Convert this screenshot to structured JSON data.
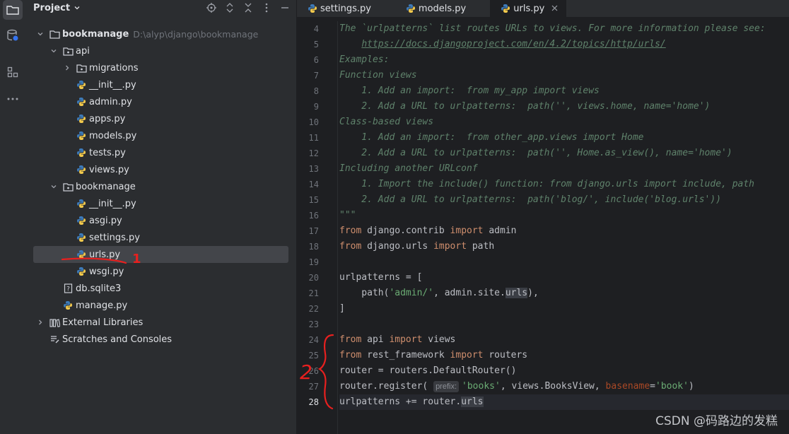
{
  "project_panel": {
    "title": "Project",
    "tree": [
      {
        "label": "bookmanage",
        "hint": "D:\\alyp\\django\\bookmanage",
        "icon": "folder-icon",
        "depth": 0,
        "expanded": true
      },
      {
        "label": "api",
        "icon": "package-folder-icon",
        "depth": 1,
        "expanded": true
      },
      {
        "label": "migrations",
        "icon": "package-folder-icon",
        "depth": 2,
        "expanded": false
      },
      {
        "label": "__init__.py",
        "icon": "python-file-icon",
        "depth": 2
      },
      {
        "label": "admin.py",
        "icon": "python-file-icon",
        "depth": 2
      },
      {
        "label": "apps.py",
        "icon": "python-file-icon",
        "depth": 2
      },
      {
        "label": "models.py",
        "icon": "python-file-icon",
        "depth": 2
      },
      {
        "label": "tests.py",
        "icon": "python-file-icon",
        "depth": 2
      },
      {
        "label": "views.py",
        "icon": "python-file-icon",
        "depth": 2
      },
      {
        "label": "bookmanage",
        "icon": "package-folder-icon",
        "depth": 1,
        "expanded": true
      },
      {
        "label": "__init__.py",
        "icon": "python-file-icon",
        "depth": 2
      },
      {
        "label": "asgi.py",
        "icon": "python-file-icon",
        "depth": 2
      },
      {
        "label": "settings.py",
        "icon": "python-file-icon",
        "depth": 2
      },
      {
        "label": "urls.py",
        "icon": "python-file-icon",
        "depth": 2,
        "selected": true
      },
      {
        "label": "wsgi.py",
        "icon": "python-file-icon",
        "depth": 2
      },
      {
        "label": "db.sqlite3",
        "icon": "unknown-file-icon",
        "depth": 1
      },
      {
        "label": "manage.py",
        "icon": "python-file-icon",
        "depth": 1
      },
      {
        "label": "External Libraries",
        "icon": "libraries-icon",
        "depth": 0,
        "expanded": false
      },
      {
        "label": "Scratches and Consoles",
        "icon": "scratches-icon",
        "depth": 0
      }
    ]
  },
  "tabs": [
    {
      "label": "settings.py",
      "active": false
    },
    {
      "label": "models.py",
      "active": false
    },
    {
      "label": "urls.py",
      "active": true
    }
  ],
  "editor": {
    "lines": [
      {
        "n": "4",
        "html": "<span class=\"doc\">The `urlpatterns` list routes URLs to views. For more information please see:</span>"
      },
      {
        "n": "5",
        "html": "<span class=\"doc\">    <a>https://docs.djangoproject.com/en/4.2/topics/http/urls/</a></span>"
      },
      {
        "n": "6",
        "html": "<span class=\"doc\">Examples:</span>"
      },
      {
        "n": "7",
        "html": "<span class=\"doc\">Function views</span>"
      },
      {
        "n": "8",
        "html": "<span class=\"doc\">    1. Add an import:  from my_app import views</span>"
      },
      {
        "n": "9",
        "html": "<span class=\"doc\">    2. Add a URL to urlpatterns:  path('', views.home, name='home')</span>"
      },
      {
        "n": "10",
        "html": "<span class=\"doc\">Class-based views</span>"
      },
      {
        "n": "11",
        "html": "<span class=\"doc\">    1. Add an import:  from other_app.views import Home</span>"
      },
      {
        "n": "12",
        "html": "<span class=\"doc\">    2. Add a URL to urlpatterns:  path('', Home.as_view(), name='home')</span>"
      },
      {
        "n": "13",
        "html": "<span class=\"doc\">Including another URLconf</span>"
      },
      {
        "n": "14",
        "html": "<span class=\"doc\">    1. Import the include() function: from django.urls import include, path</span>"
      },
      {
        "n": "15",
        "html": "<span class=\"doc\">    2. Add a URL to urlpatterns:  path('blog/', include('blog.urls'))</span>"
      },
      {
        "n": "16",
        "html": "<span class=\"doc\">\"\"\"</span>"
      },
      {
        "n": "17",
        "html": "<span class=\"kw\">from</span> django.contrib <span class=\"kw\">import</span> admin"
      },
      {
        "n": "18",
        "html": "<span class=\"kw\">from</span> django.urls <span class=\"kw\">import</span> path"
      },
      {
        "n": "19",
        "html": ""
      },
      {
        "n": "20",
        "html": "urlpatterns = ["
      },
      {
        "n": "21",
        "html": "    path(<span class=\"str\">'admin/'</span>, admin.site.<span class=\"hl\">urls</span>),"
      },
      {
        "n": "22",
        "html": "]"
      },
      {
        "n": "23",
        "html": ""
      },
      {
        "n": "24",
        "html": "<span class=\"kw\">from</span> api <span class=\"kw\">import</span> views"
      },
      {
        "n": "25",
        "html": "<span class=\"kw\">from</span> rest_framework <span class=\"kw\">import</span> routers"
      },
      {
        "n": "26",
        "html": "router = routers.DefaultRouter()"
      },
      {
        "n": "27",
        "html": "router.register( <span class=\"hint\">prefix:</span><span class=\"str\">'books'</span>, views.BooksView, <span class=\"param\">basename</span>=<span class=\"str\">'book'</span>)"
      },
      {
        "n": "28",
        "html": "urlpatterns += router.<span class=\"hl\">urls</span>",
        "current": true
      }
    ]
  },
  "watermark": "CSDN @码路边的发糕",
  "annotations": {
    "mark_1": "1",
    "mark_2": "2"
  },
  "colors": {
    "annotation": "#e8201f",
    "keyword": "#cf8e6d",
    "string": "#6aab73",
    "docstring": "#5f826b"
  }
}
